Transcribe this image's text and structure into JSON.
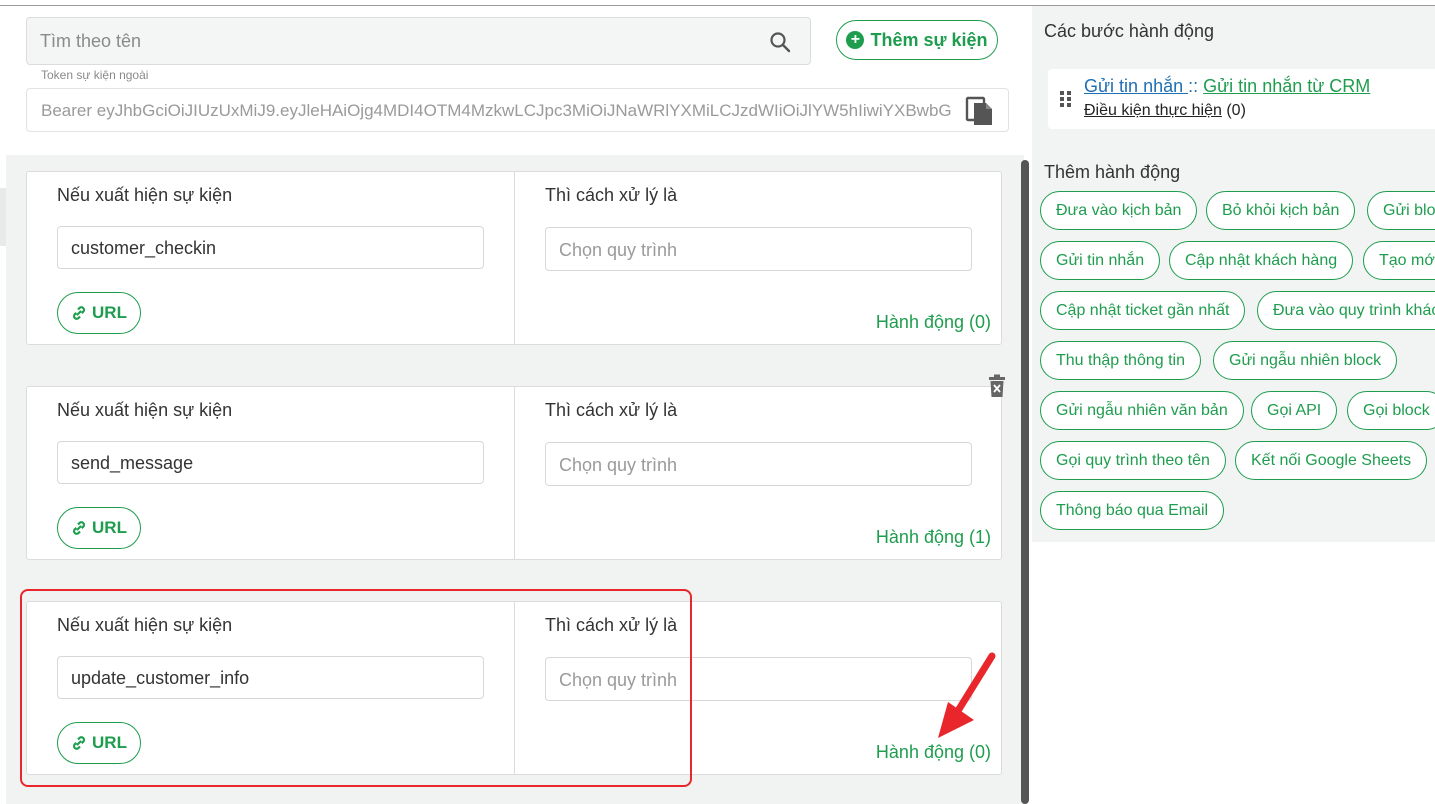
{
  "search": {
    "placeholder": "Tìm theo tên"
  },
  "add_event_label": "Thêm sự kiện",
  "token": {
    "label": "Token sự kiện ngoài",
    "value": "Bearer eyJhbGciOiJIUzUxMiJ9.eyJleHAiOjg4MDI4OTM4MzkwLCJpc3MiOiJNaWRlYXMiLCJzdWIiOiJlYW5hIiwiYXBwbG"
  },
  "events": [
    {
      "if_label": "Nếu xuất hiện sự kiện",
      "then_label": "Thì cách xử lý là",
      "event_name": "customer_checkin",
      "flow_placeholder": "Chọn quy trình",
      "url_label": "URL",
      "actions": "Hành động (0)"
    },
    {
      "if_label": "Nếu xuất hiện sự kiện",
      "then_label": "Thì cách xử lý là",
      "event_name": "send_message",
      "flow_placeholder": "Chọn quy trình",
      "url_label": "URL",
      "actions": "Hành động (1)"
    },
    {
      "if_label": "Nếu xuất hiện sự kiện",
      "then_label": "Thì cách xử lý là",
      "event_name": "update_customer_info",
      "flow_placeholder": "Chọn quy trình",
      "url_label": "URL",
      "actions": "Hành động (0)"
    }
  ],
  "right_panel": {
    "steps_title": "Các bước hành động",
    "step": {
      "action": "Gửi tin nhắn ",
      "separator": ":: ",
      "target": "Gửi tin nhắn từ CRM",
      "condition_label": "Điều kiện thực hiện",
      "condition_count": " (0)"
    },
    "add_action_title": "Thêm hành động",
    "chips": [
      "Đưa vào kịch bản",
      "Bỏ khỏi kịch bản",
      "Gửi block",
      "Gửi tin nhắn",
      "Cập nhật khách hàng",
      "Tạo mới",
      "Cập nhật ticket gần nhất",
      "Đưa vào quy trình khác",
      "Thu thập thông tin",
      "Gửi ngẫu nhiên block",
      "Gửi ngẫu nhiên văn bản",
      "Gọi API",
      "Gọi block",
      "Gọi quy trình theo tên",
      "Kết nối Google Sheets",
      "Thông báo qua Email"
    ]
  },
  "colors": {
    "accent": "#1f9d4e",
    "link_blue": "#1f6fb3",
    "highlight_red": "#e8262b"
  }
}
